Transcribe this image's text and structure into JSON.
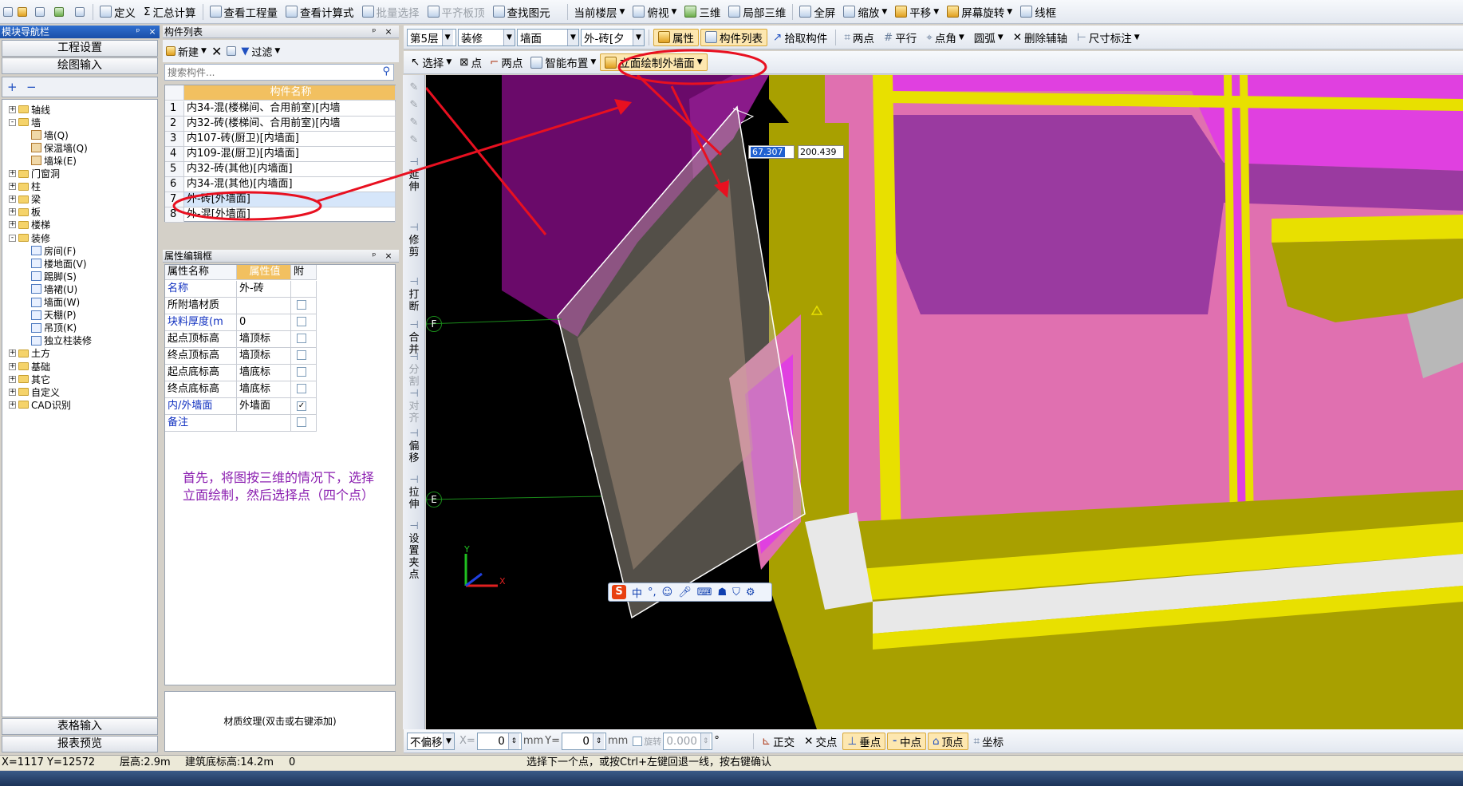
{
  "toolbar1": {
    "define": "定义",
    "sum_calc": "汇总计算",
    "view_quantity": "查看工程量",
    "view_formula": "查看计算式",
    "batch_select": "批量选择",
    "flush_slab": "平齐板顶",
    "find_element": "查找图元",
    "current_floor": "当前楼层",
    "top_view": "俯视",
    "three_d": "三维",
    "local_3d": "局部三维",
    "fullscreen": "全屏",
    "zoom": "缩放",
    "pan": "平移",
    "rotate": "屏幕旋转",
    "wireframe": "线框"
  },
  "toolbar2": {
    "floor": "第5层",
    "category": "装修",
    "type": "墙面",
    "component": "外-砖[夕",
    "properties": "属性",
    "component_list": "构件列表",
    "pick": "拾取构件",
    "two_points": "两点",
    "parallel": "平行",
    "point_angle": "点角",
    "arc": "圆弧",
    "delete_aux": "删除辅轴",
    "dimension": "尺寸标注"
  },
  "toolbar3": {
    "select": "选择",
    "point": "点",
    "two_points": "两点",
    "smart_layout": "智能布置",
    "elevation_draw": "立面绘制外墙面"
  },
  "module_nav": {
    "title": "模块导航栏",
    "project_settings": "工程设置",
    "drawing_input": "绘图输入",
    "table_input": "表格输入",
    "report_preview": "报表预览",
    "tree": [
      {
        "label": "轴线",
        "depth": 0,
        "sign": "+"
      },
      {
        "label": "墙",
        "depth": 0,
        "sign": "-"
      },
      {
        "label": "墙(Q)",
        "depth": 1
      },
      {
        "label": "保温墙(Q)",
        "depth": 1
      },
      {
        "label": "墙垛(E)",
        "depth": 1
      },
      {
        "label": "门窗洞",
        "depth": 0,
        "sign": "+"
      },
      {
        "label": "柱",
        "depth": 0,
        "sign": "+"
      },
      {
        "label": "梁",
        "depth": 0,
        "sign": "+"
      },
      {
        "label": "板",
        "depth": 0,
        "sign": "+"
      },
      {
        "label": "楼梯",
        "depth": 0,
        "sign": "+"
      },
      {
        "label": "装修",
        "depth": 0,
        "sign": "-"
      },
      {
        "label": "房间(F)",
        "depth": 1
      },
      {
        "label": "楼地面(V)",
        "depth": 1
      },
      {
        "label": "踢脚(S)",
        "depth": 1
      },
      {
        "label": "墙裙(U)",
        "depth": 1
      },
      {
        "label": "墙面(W)",
        "depth": 1
      },
      {
        "label": "天棚(P)",
        "depth": 1
      },
      {
        "label": "吊顶(K)",
        "depth": 1
      },
      {
        "label": "独立柱装修",
        "depth": 1
      },
      {
        "label": "土方",
        "depth": 0,
        "sign": "+"
      },
      {
        "label": "基础",
        "depth": 0,
        "sign": "+"
      },
      {
        "label": "其它",
        "depth": 0,
        "sign": "+"
      },
      {
        "label": "自定义",
        "depth": 0,
        "sign": "+"
      },
      {
        "label": "CAD识别",
        "depth": 0,
        "sign": "+"
      }
    ]
  },
  "component_list": {
    "title": "构件列表",
    "new": "新建",
    "filter": "过滤",
    "search_placeholder": "搜索构件...",
    "header": "构件名称",
    "rows": [
      {
        "no": "1",
        "name": "内34-混(楼梯间、合用前室)[内墙"
      },
      {
        "no": "2",
        "name": "内32-砖(楼梯间、合用前室)[内墙"
      },
      {
        "no": "3",
        "name": "内107-砖(厨卫)[内墙面]"
      },
      {
        "no": "4",
        "name": "内109-混(厨卫)[内墙面]"
      },
      {
        "no": "5",
        "name": "内32-砖(其他)[内墙面]"
      },
      {
        "no": "6",
        "name": "内34-混(其他)[内墙面]"
      },
      {
        "no": "7",
        "name": "外-砖[外墙面]"
      },
      {
        "no": "8",
        "name": "外-混[外墙面]"
      }
    ]
  },
  "property_editor": {
    "title": "属性编辑框",
    "col_name": "属性名称",
    "col_value": "属性值",
    "col_attach": "附",
    "rows": [
      {
        "name": "名称",
        "value": "外-砖",
        "blue": true,
        "check": false,
        "hasCheck": false
      },
      {
        "name": "所附墙材质",
        "value": "",
        "blue": false,
        "check": false,
        "hasCheck": true
      },
      {
        "name": "块料厚度(m",
        "value": "0",
        "blue": true,
        "check": false,
        "hasCheck": true
      },
      {
        "name": "起点顶标高",
        "value": "墙顶标",
        "blue": false,
        "check": false,
        "hasCheck": true
      },
      {
        "name": "终点顶标高",
        "value": "墙顶标",
        "blue": false,
        "check": false,
        "hasCheck": true
      },
      {
        "name": "起点底标高",
        "value": "墙底标",
        "blue": false,
        "check": false,
        "hasCheck": true
      },
      {
        "name": "终点底标高",
        "value": "墙底标",
        "blue": false,
        "check": false,
        "hasCheck": true
      },
      {
        "name": "内/外墙面",
        "value": "外墙面",
        "blue": true,
        "check": true,
        "hasCheck": true
      },
      {
        "name": "备注",
        "value": "",
        "blue": true,
        "check": false,
        "hasCheck": true
      }
    ],
    "texture_hint": "材质纹理(双击或右键添加)"
  },
  "annotation": {
    "line1": "首先，将图按三维的情况下，选择",
    "line2": "立面绘制，然后选择点（四个点）"
  },
  "vertical_tools": [
    "延伸",
    "修剪",
    "打断",
    "合并",
    "分割",
    "对齐",
    "偏移",
    "拉伸",
    "设置夹点"
  ],
  "viewport": {
    "dim1": "67.307",
    "dim2": "200.439",
    "axis_f": "F",
    "axis_e": "E",
    "axis_y": "Y",
    "axis_x": "X",
    "ime_logo": "S",
    "ime_mode": "中"
  },
  "bottom_bar": {
    "offset": "不偏移",
    "x_label": "X=",
    "x_value": "0",
    "y_label": "Y=",
    "y_value": "0",
    "unit": "mm",
    "rotate": "旋转",
    "rotate_value": "0.000",
    "degree": "°",
    "ortho": "正交",
    "intersect": "交点",
    "perp": "垂点",
    "mid": "中点",
    "vertex": "顶点",
    "coord": "坐标"
  },
  "status_bar": {
    "coords": "X=1117 Y=12572",
    "floor_height": "层高:2.9m",
    "base_elev": "建筑底标高:14.2m",
    "zero": "0",
    "hint": "选择下一个点，或按Ctrl+左键回退一线，按右键确认"
  },
  "colors": {
    "magenta": "#e040e0",
    "pink": "#e070b0",
    "yellow": "#e8e000",
    "olive": "#a8a000",
    "purple": "#6a0a6a",
    "annotation_red": "#e81020"
  }
}
